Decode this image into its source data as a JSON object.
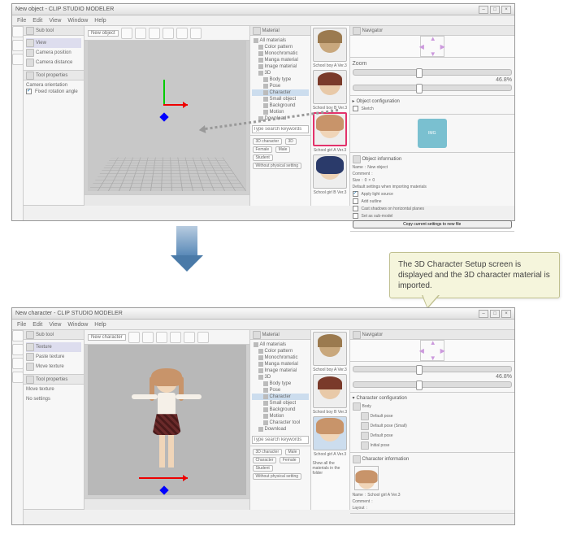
{
  "app_title": "CLIP STUDIO MODELER",
  "win1_doc": "New object",
  "win2_doc": "New character",
  "menus": [
    "File",
    "Edit",
    "View",
    "Window",
    "Help"
  ],
  "p_subtool": "Sub tool",
  "st_view": "View",
  "st_cam_pos": "Camera position",
  "st_cam_dist": "Camera distance",
  "st_texture": "Texture",
  "st_paste": "Paste texture",
  "st_move": "Move texture",
  "p_toolprop": "Tool properties",
  "tp_cam_orient": "Camera orientation",
  "tp_fixed": "Fixed rotation angle",
  "tp_move": "Move texture",
  "tp_nosettings": "No settings",
  "p_material": "Material",
  "tree": {
    "all": "All materials",
    "color": "Color pattern",
    "mono": "Monochromatic",
    "manga": "Manga material",
    "image": "Image material",
    "three": "3D",
    "body": "Body type",
    "pose": "Pose",
    "char": "Character",
    "small": "Small object",
    "bg": "Background",
    "motion": "Motion",
    "chartool": "Character tool",
    "download": "Download"
  },
  "thumbs": {
    "b1": "School boy A Ver.3",
    "b2": "School boy B Ver.3",
    "g1": "School girl A Ver.3",
    "g2": "School girl B Ver.3"
  },
  "search_ph": "Type search keywords",
  "show_all": "Show all the materials in the folder",
  "tags": [
    "3D character",
    "3D",
    "Character",
    "Female",
    "Male",
    "Student",
    "Without physical setting"
  ],
  "nav_label": "Navigator",
  "zoom_val": "46.8%",
  "p_objconf": "Object configuration",
  "p_sketch": "Sketch",
  "p_objinfo": "Object information",
  "p_charconf": "Character configuration",
  "p_charinfo": "Character information",
  "info": {
    "name_l": "Name",
    "name_v": "New object",
    "comment_l": "Comment",
    "size_l": "Size",
    "size_w": "0",
    "size_h": "0",
    "def_l": "Default settings when importing materials",
    "apply": "Apply light source",
    "shadow": "Add outline",
    "cast": "Cast shadows on horizontal planes",
    "scale": "Set as sub-model",
    "btn": "Copy current settings to new file"
  },
  "body_list": [
    "Body",
    "Default pose",
    "Default pose (Small)",
    "Default pose",
    "Initial pose"
  ],
  "char_name": "School girl A Ver.3",
  "layout_l": "Layout",
  "callout": "The 3D Character Setup screen is displayed and the 3D character material is imported."
}
